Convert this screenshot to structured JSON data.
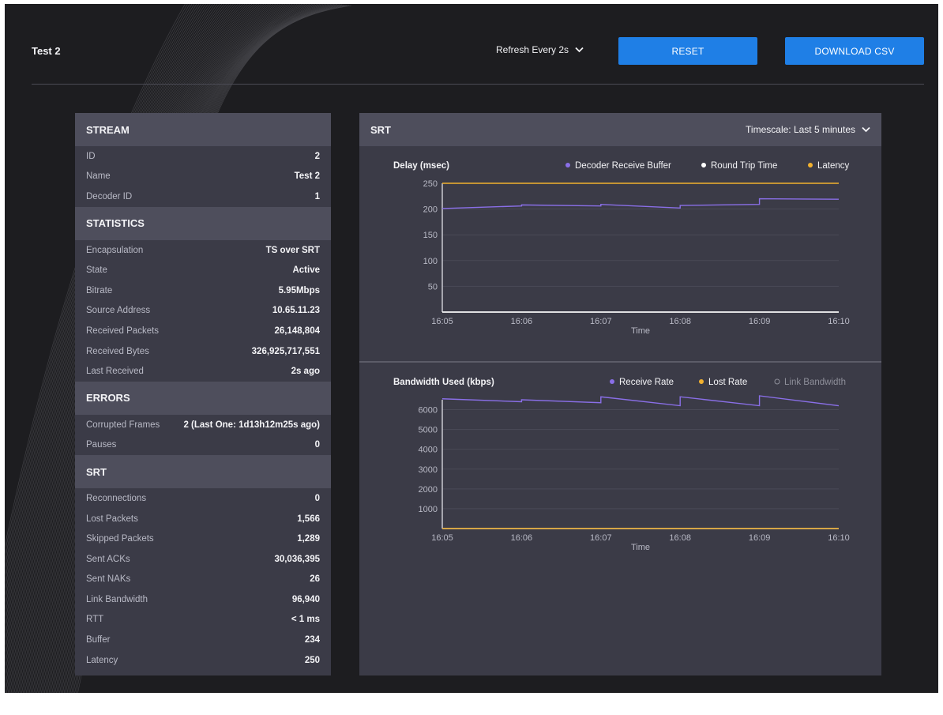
{
  "topbar": {
    "title": "Test 2",
    "refresh_label": "Refresh Every 2s",
    "reset_label": "RESET",
    "download_label": "DOWNLOAD CSV"
  },
  "stream_panel": {
    "sections": [
      {
        "title": "STREAM",
        "rows": [
          {
            "label": "ID",
            "value": "2"
          },
          {
            "label": "Name",
            "value": "Test 2"
          },
          {
            "label": "Decoder ID",
            "value": "1"
          }
        ]
      },
      {
        "title": "STATISTICS",
        "rows": [
          {
            "label": "Encapsulation",
            "value": "TS over SRT"
          },
          {
            "label": "State",
            "value": "Active"
          },
          {
            "label": "Bitrate",
            "value": "5.95Mbps"
          },
          {
            "label": "Source Address",
            "value": "10.65.11.23"
          },
          {
            "label": "Received Packets",
            "value": "26,148,804"
          },
          {
            "label": "Received Bytes",
            "value": "326,925,717,551"
          },
          {
            "label": "Last Received",
            "value": "2s ago"
          }
        ]
      },
      {
        "title": "ERRORS",
        "rows": [
          {
            "label": "Corrupted Frames",
            "value": "2 (Last One: 1d13h12m25s ago)"
          },
          {
            "label": "Pauses",
            "value": "0"
          }
        ]
      },
      {
        "title": "SRT",
        "rows": [
          {
            "label": "Reconnections",
            "value": "0"
          },
          {
            "label": "Lost Packets",
            "value": "1,566"
          },
          {
            "label": "Skipped Packets",
            "value": "1,289"
          },
          {
            "label": "Sent ACKs",
            "value": "30,036,395"
          },
          {
            "label": "Sent NAKs",
            "value": "26"
          },
          {
            "label": "Link Bandwidth",
            "value": "96,940"
          },
          {
            "label": "RTT",
            "value": "< 1 ms"
          },
          {
            "label": "Buffer",
            "value": "234"
          },
          {
            "label": "Latency",
            "value": "250"
          }
        ]
      }
    ]
  },
  "srt_panel": {
    "title": "SRT",
    "timescale_label": "Timescale: Last 5 minutes"
  },
  "colors": {
    "accent": "#1f7fe6",
    "purple": "#8a6fe8",
    "white": "#ffffff",
    "yellow": "#f2b12f",
    "grey": "#8e8f9a"
  },
  "chart_data": [
    {
      "type": "line",
      "title": "Delay (msec)",
      "xlabel": "Time",
      "ylabel": "",
      "x_ticks": [
        "16:05",
        "16:06",
        "16:07",
        "16:08",
        "16:09",
        "16:10"
      ],
      "y_ticks": [
        50,
        100,
        150,
        200,
        250
      ],
      "ylim": [
        0,
        250
      ],
      "xlim": [
        0,
        5
      ],
      "legend": [
        "Decoder Receive Buffer",
        "Round Trip Time",
        "Latency"
      ],
      "series": [
        {
          "name": "Decoder Receive Buffer",
          "color": "#8a6fe8",
          "x": [
            0,
            1,
            1,
            2,
            2,
            3,
            3,
            4,
            4,
            5
          ],
          "y": [
            201,
            206,
            208,
            206,
            209,
            202,
            207,
            209,
            220,
            219
          ]
        },
        {
          "name": "Round Trip Time",
          "color": "#ffffff",
          "x": [
            0,
            5
          ],
          "y": [
            0,
            0
          ]
        },
        {
          "name": "Latency",
          "color": "#f2b12f",
          "x": [
            0,
            5
          ],
          "y": [
            250,
            250
          ]
        }
      ]
    },
    {
      "type": "line",
      "title": "Bandwidth Used (kbps)",
      "xlabel": "Time",
      "ylabel": "",
      "x_ticks": [
        "16:05",
        "16:06",
        "16:07",
        "16:08",
        "16:09",
        "16:10"
      ],
      "y_ticks": [
        1000,
        2000,
        3000,
        4000,
        5000,
        6000
      ],
      "ylim": [
        0,
        6500
      ],
      "xlim": [
        0,
        5
      ],
      "legend": [
        "Receive Rate",
        "Lost Rate",
        "Link Bandwidth"
      ],
      "series": [
        {
          "name": "Receive Rate",
          "color": "#8a6fe8",
          "x": [
            0,
            1,
            1,
            2,
            2,
            3,
            3,
            4,
            4,
            5
          ],
          "y": [
            6550,
            6400,
            6500,
            6350,
            6650,
            6200,
            6650,
            6200,
            6700,
            6200
          ]
        },
        {
          "name": "Lost Rate",
          "color": "#f2b12f",
          "x": [
            0,
            5
          ],
          "y": [
            0,
            0
          ]
        },
        {
          "name": "Link Bandwidth",
          "color": "#8e8f9a",
          "x": [],
          "y": []
        }
      ]
    }
  ]
}
